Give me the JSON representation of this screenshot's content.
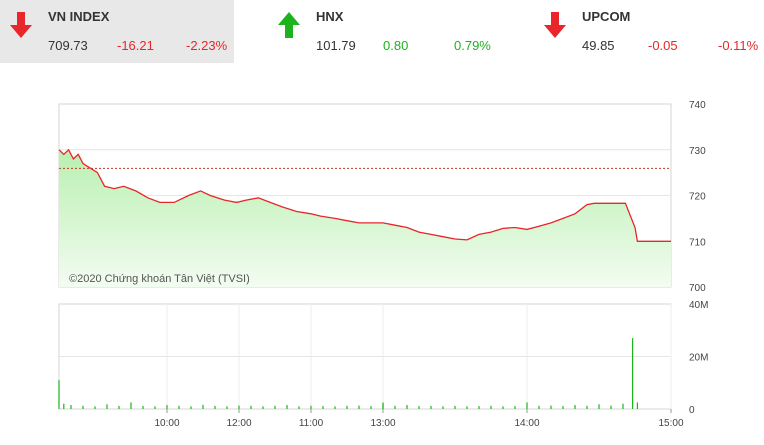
{
  "indices": [
    {
      "name": "VN INDEX",
      "value": "709.73",
      "change": "-16.21",
      "pct": "-2.23%",
      "direction": "down",
      "color": "#e8262b"
    },
    {
      "name": "HNX",
      "value": "101.79",
      "change": "0.80",
      "pct": "0.79%",
      "direction": "up",
      "color": "#1db31d"
    },
    {
      "name": "UPCOM",
      "value": "49.85",
      "change": "-0.05",
      "pct": "-0.11%",
      "direction": "down",
      "color": "#e8262b"
    }
  ],
  "chart_data": [
    {
      "type": "area",
      "ylim": [
        700,
        740
      ],
      "yticks": [
        "740",
        "730",
        "720",
        "710",
        "700"
      ],
      "reference": 725.94,
      "watermark": "©2020 Chứng khoán Tân Việt (TVSI)",
      "colors": {
        "line": "#e8262b",
        "fill_top": "#b9f0b0",
        "fill_bottom": "#f3fcf1",
        "reference": "#c0392b"
      },
      "x": [
        "09:15",
        "09:17",
        "09:19",
        "09:21",
        "09:23",
        "09:25",
        "09:28",
        "09:31",
        "09:34",
        "09:38",
        "09:42",
        "09:47",
        "09:52",
        "09:57",
        "10:03",
        "10:09",
        "10:14",
        "10:18",
        "10:24",
        "10:29",
        "10:33",
        "10:38",
        "10:43",
        "10:48",
        "10:54",
        "11:00",
        "11:04",
        "11:10",
        "11:15",
        "11:20",
        "11:25",
        "11:30",
        "13:00",
        "13:05",
        "13:10",
        "13:15",
        "13:20",
        "13:25",
        "13:30",
        "13:35",
        "13:40",
        "13:45",
        "13:50",
        "13:55",
        "14:00",
        "14:05",
        "14:10",
        "14:15",
        "14:20",
        "14:25",
        "14:28",
        "14:30",
        "14:41",
        "14:45",
        "14:46",
        "15:00"
      ],
      "y": [
        730,
        729,
        730,
        728,
        729,
        727,
        726,
        725,
        722,
        721.5,
        722,
        721,
        719.5,
        718.5,
        718.5,
        720,
        721,
        720,
        719,
        718.5,
        719,
        719.5,
        718.5,
        717.5,
        716.5,
        716,
        715.5,
        715,
        714.5,
        714,
        714,
        714,
        714,
        713.5,
        713,
        712,
        711.5,
        711,
        710.5,
        710.3,
        711.5,
        712,
        712.8,
        713,
        712.6,
        713.3,
        714,
        715,
        716,
        718,
        718.3,
        718.3,
        718.3,
        713,
        710,
        710
      ]
    },
    {
      "type": "bar",
      "ylim": [
        0,
        40
      ],
      "yticks": [
        "40M",
        "20M",
        "0"
      ],
      "xticks": [
        "10:00",
        "11:00",
        "12:00",
        "13:00",
        "14:00",
        "15:00"
      ],
      "colors": {
        "bar": "#1db31d"
      },
      "x": [
        "09:15",
        "09:17",
        "09:20",
        "09:25",
        "09:30",
        "09:35",
        "09:40",
        "09:45",
        "09:50",
        "09:55",
        "10:00",
        "10:05",
        "10:10",
        "10:15",
        "10:20",
        "10:25",
        "10:30",
        "10:35",
        "10:40",
        "10:45",
        "10:50",
        "10:55",
        "11:00",
        "11:05",
        "11:10",
        "11:15",
        "11:20",
        "11:25",
        "11:30",
        "13:00",
        "13:05",
        "13:10",
        "13:15",
        "13:20",
        "13:25",
        "13:30",
        "13:35",
        "13:40",
        "13:45",
        "13:50",
        "13:55",
        "14:00",
        "14:05",
        "14:10",
        "14:15",
        "14:20",
        "14:25",
        "14:30",
        "14:35",
        "14:40",
        "14:44",
        "14:46"
      ],
      "values": [
        11,
        2,
        1.5,
        1.2,
        1,
        1.8,
        1.2,
        2.5,
        1.2,
        1,
        1.5,
        1.2,
        1,
        1.6,
        1.2,
        1,
        1.3,
        1.2,
        1,
        1.2,
        1.5,
        1,
        1.2,
        1.1,
        1,
        1.2,
        1.3,
        1.1,
        2,
        2.5,
        1.2,
        1.5,
        1.1,
        1.2,
        1,
        1.2,
        1,
        1.1,
        1.2,
        1,
        1.1,
        2.5,
        1.2,
        1.3,
        1.1,
        1.5,
        1.2,
        1.8,
        1.3,
        2,
        27,
        2.5
      ]
    }
  ]
}
